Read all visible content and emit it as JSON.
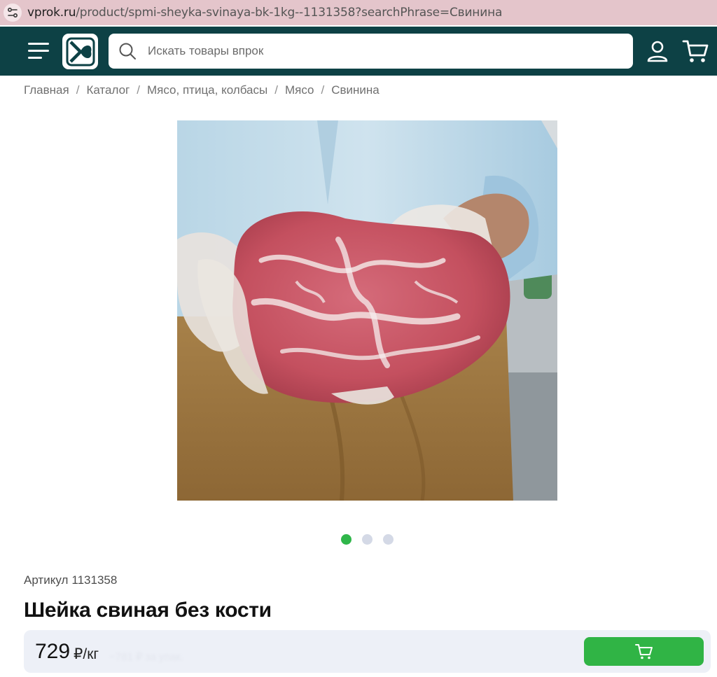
{
  "browser": {
    "url_domain": "vprok.ru",
    "url_path": "/product/spmi-sheyka-svinaya-bk-1kg--1131358?searchPhrase=Свинина"
  },
  "header": {
    "brand_color": "#0d4145",
    "search_placeholder": "Искать товары впрок"
  },
  "breadcrumbs": [
    "Главная",
    "Каталог",
    "Мясо, птица, колбасы",
    "Мясо",
    "Свинина"
  ],
  "gallery": {
    "image_alt": "pork-neck-photo",
    "slides": 3,
    "active_slide": 1,
    "active_color": "#2fb64a"
  },
  "product": {
    "sku_label": "Артикул",
    "sku": "1131358",
    "title": "Шейка свиная без кости",
    "price": "729",
    "price_unit": "₽/кг",
    "price_note_blurred": "~781 ₽ за упак."
  },
  "buy_button": {
    "icon": "cart-icon",
    "color": "#30b445"
  }
}
